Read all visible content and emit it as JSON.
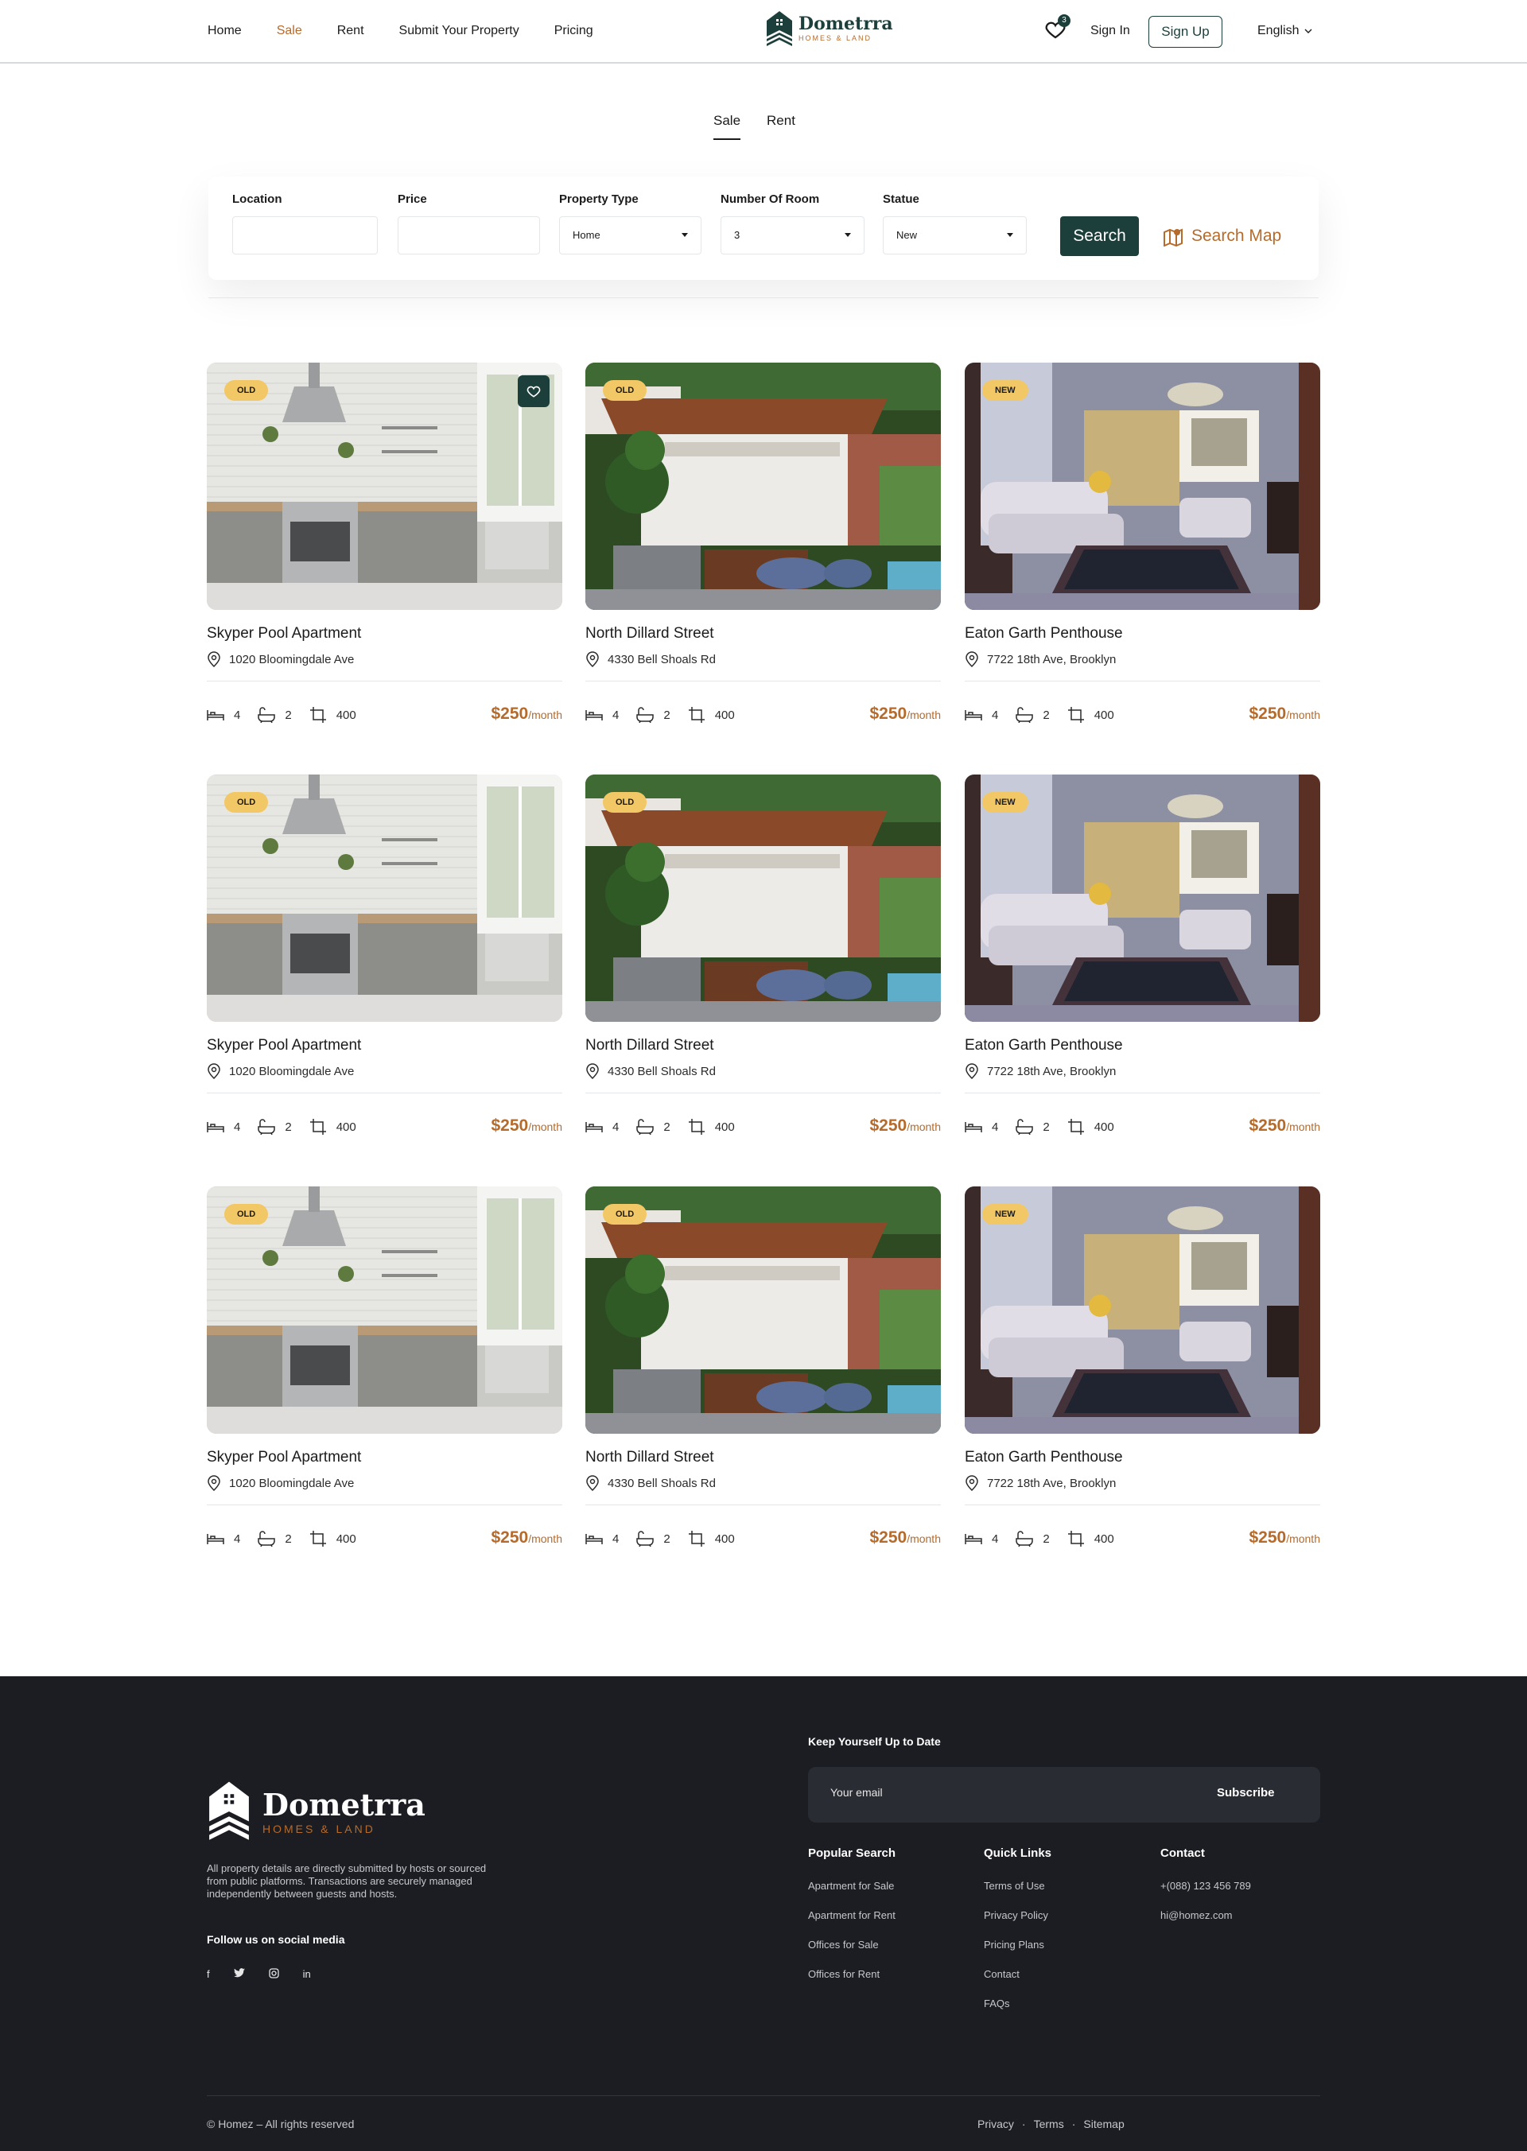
{
  "header": {
    "nav": [
      "Home",
      "Sale",
      "Rent",
      "Submit Your Property",
      "Pricing"
    ],
    "active_nav": "Sale",
    "brand_name": "Dometrra",
    "brand_tagline": "HOMES & LAND",
    "favorites_count": "3",
    "sign_in": "Sign In",
    "sign_up": "Sign Up",
    "language": "English"
  },
  "tabs": [
    "Sale",
    "Rent"
  ],
  "search": {
    "location_label": "Location",
    "price_label": "Price",
    "property_type_label": "Property Type",
    "property_type_value": "Home",
    "rooms_label": "Number Of Room",
    "rooms_value": "3",
    "statue_label": "Statue",
    "statue_value": "New",
    "search_button": "Search",
    "search_map": "Search Map"
  },
  "listings": [
    {
      "badge": "OLD",
      "title": "Skyper Pool Apartment",
      "address": "1020 Bloomingdale Ave",
      "beds": "4",
      "baths": "2",
      "area": "400",
      "price": "$250",
      "per": "/month",
      "image": "kitchen"
    },
    {
      "badge": "OLD",
      "title": "North Dillard Street",
      "address": "4330 Bell Shoals Rd",
      "beds": "4",
      "baths": "2",
      "area": "400",
      "price": "$250",
      "per": "/month",
      "image": "patio"
    },
    {
      "badge": "NEW",
      "title": "Eaton Garth Penthouse",
      "address": "7722 18th Ave, Brooklyn",
      "beds": "4",
      "baths": "2",
      "area": "400",
      "price": "$250",
      "per": "/month",
      "image": "living"
    },
    {
      "badge": "OLD",
      "title": "Skyper Pool Apartment",
      "address": "1020 Bloomingdale Ave",
      "beds": "4",
      "baths": "2",
      "area": "400",
      "price": "$250",
      "per": "/month",
      "image": "kitchen"
    },
    {
      "badge": "OLD",
      "title": "North Dillard Street",
      "address": "4330 Bell Shoals Rd",
      "beds": "4",
      "baths": "2",
      "area": "400",
      "price": "$250",
      "per": "/month",
      "image": "patio"
    },
    {
      "badge": "NEW",
      "title": "Eaton Garth Penthouse",
      "address": "7722 18th Ave, Brooklyn",
      "beds": "4",
      "baths": "2",
      "area": "400",
      "price": "$250",
      "per": "/month",
      "image": "living"
    },
    {
      "badge": "OLD",
      "title": "Skyper Pool Apartment",
      "address": "1020 Bloomingdale Ave",
      "beds": "4",
      "baths": "2",
      "area": "400",
      "price": "$250",
      "per": "/month",
      "image": "kitchen"
    },
    {
      "badge": "OLD",
      "title": "North Dillard Street",
      "address": "4330 Bell Shoals Rd",
      "beds": "4",
      "baths": "2",
      "area": "400",
      "price": "$250",
      "per": "/month",
      "image": "patio"
    },
    {
      "badge": "NEW",
      "title": "Eaton Garth Penthouse",
      "address": "7722 18th Ave, Brooklyn",
      "beds": "4",
      "baths": "2",
      "area": "400",
      "price": "$250",
      "per": "/month",
      "image": "living"
    }
  ],
  "footer": {
    "brand_name": "Dometrra",
    "brand_tagline": "HOMES & LAND",
    "description": "All property details are directly submitted by hosts or sourced from public platforms. Transactions are securely managed independently between guests and hosts.",
    "follow_title": "Follow us on social media",
    "socials": [
      "f",
      "t",
      "ig",
      "in"
    ],
    "newsletter_title": "Keep Yourself Up to Date",
    "email_placeholder": "Your email",
    "subscribe": "Subscribe",
    "columns": [
      {
        "title": "Popular Search",
        "links": [
          "Apartment for Sale",
          "Apartment for Rent",
          "Offices for Sale",
          "Offices for Rent"
        ]
      },
      {
        "title": "Quick Links",
        "links": [
          "Terms of Use",
          "Privacy Policy",
          "Pricing Plans",
          "Contact",
          "FAQs"
        ]
      },
      {
        "title": "Contact",
        "links": [
          "+(088) 123 456 789",
          "hi@homez.com"
        ]
      }
    ],
    "copyright": "© Homez – All rights reserved",
    "bottom_links": [
      "Privacy",
      "Terms",
      "Sitemap"
    ]
  },
  "colors": {
    "primary": "#1d3f3b",
    "accent": "#b56b2c",
    "badge": "#f2c766",
    "footer_bg": "#1b1d23"
  }
}
